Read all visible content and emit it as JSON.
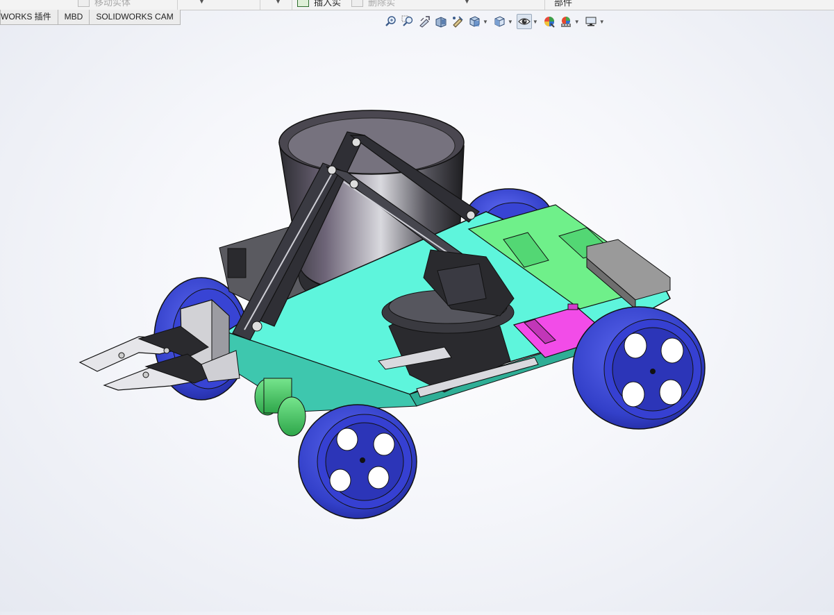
{
  "ribbon": {
    "partial_labels": [
      {
        "text": "移动实体",
        "state": "disabled"
      },
      {
        "text": "插入实",
        "state": "normal"
      },
      {
        "text": "删除实",
        "state": "disabled"
      },
      {
        "text": "部件",
        "state": "normal"
      }
    ]
  },
  "tabs": [
    {
      "label": "WORKS 插件"
    },
    {
      "label": "MBD"
    },
    {
      "label": "SOLIDWORKS CAM"
    }
  ],
  "view_toolbar": {
    "buttons": [
      {
        "icon": "zoom-to-fit-icon"
      },
      {
        "icon": "zoom-to-area-icon"
      },
      {
        "icon": "previous-view-icon"
      },
      {
        "icon": "section-view-icon"
      },
      {
        "icon": "dynamic-annotation-views-icon"
      },
      {
        "icon": "view-orientation-icon",
        "dropdown": true
      },
      {
        "icon": "display-style-icon",
        "dropdown": true
      },
      {
        "icon": "hide-show-items-icon",
        "dropdown": true,
        "active": true
      },
      {
        "icon": "edit-appearance-icon"
      },
      {
        "icon": "apply-scene-icon",
        "dropdown": true
      },
      {
        "icon": "view-settings-icon",
        "dropdown": true
      }
    ]
  },
  "model": {
    "description_colors": {
      "chassis": "#5ef5dc",
      "wheels": "#3b45c8",
      "boards": "#6ff08a",
      "module_pink": "#f24ce8",
      "arm": "#2a2a2e",
      "bin": "#3a3a40",
      "motors": "#3fcf63"
    }
  }
}
